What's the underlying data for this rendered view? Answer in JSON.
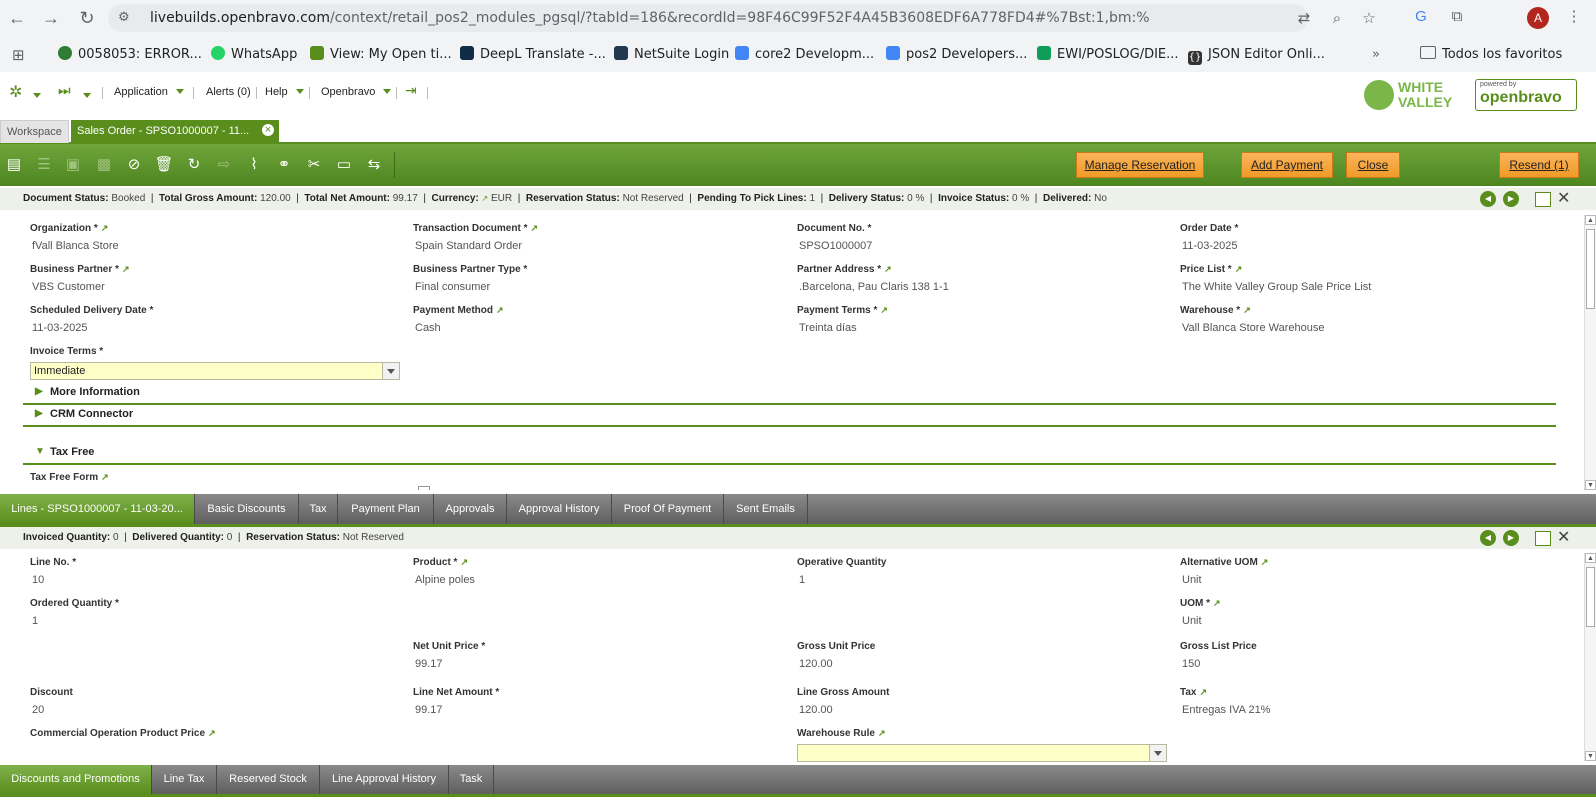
{
  "browser": {
    "url_host": "livebuilds.openbravo.com",
    "url_rest": "/context/retail_pos2_modules_pgsql/?tabId=186&recordId=98F46C99F52F4A45B3608EDF6A778FD4#%7Bst:1,bm:%5B%7BviewId:__OBMyOpenbravoImpl...",
    "avatar_letter": "A",
    "bookmarks": [
      {
        "label": "0058053: ERROR...",
        "color": "#2e7d32"
      },
      {
        "label": "WhatsApp",
        "color": "#25d366"
      },
      {
        "label": "View: My Open ti...",
        "color": "#5a8e1c"
      },
      {
        "label": "DeepL Translate -...",
        "color": "#0f2b46"
      },
      {
        "label": "NetSuite Login",
        "color": "#22384f"
      },
      {
        "label": "core2 Developm...",
        "color": "#4285f4"
      },
      {
        "label": "pos2 Developers...",
        "color": "#4285f4"
      },
      {
        "label": "EWI/POSLOG/DIE...",
        "color": "#0f9d58"
      },
      {
        "label": "JSON Editor Onli...",
        "color": "#333333"
      }
    ],
    "more_bookmarks": "»",
    "all_bookmarks": "Todos los favoritos"
  },
  "header": {
    "menu": {
      "application": "Application",
      "alerts": "Alerts (0)",
      "help": "Help",
      "openbravo": "Openbravo"
    },
    "logo_wv_line1": "WHITE",
    "logo_wv_line2": "VALLEY",
    "logo_ob_small": "powered by",
    "logo_ob": "openbravo"
  },
  "tabs": {
    "workspace": "Workspace",
    "sales_order": "Sales Order - SPSO1000007 - 11...",
    "close": "×"
  },
  "toolbar": {
    "manage_reservation": "Manage Reservation",
    "add_payment": "Add Payment",
    "close": "Close",
    "resend": "Resend (1)"
  },
  "header_status": {
    "document_status_label": "Document Status:",
    "document_status": "Booked",
    "total_gross_label": "Total Gross Amount:",
    "total_gross": "120.00",
    "total_net_label": "Total Net Amount:",
    "total_net": "99.17",
    "currency_label": "Currency:",
    "currency": "EUR",
    "reservation_label": "Reservation Status:",
    "reservation": "Not Reserved",
    "pending_label": "Pending To Pick Lines:",
    "pending": "1",
    "delivery_label": "Delivery Status:",
    "delivery": "0 %",
    "invoice_label": "Invoice Status:",
    "invoice": "0 %",
    "delivered_label": "Delivered:",
    "delivered": "No"
  },
  "header_form": {
    "organization_label": "Organization *",
    "organization": "fVall Blanca Store",
    "transaction_document_label": "Transaction Document *",
    "transaction_document": "Spain Standard Order",
    "document_no_label": "Document No. *",
    "document_no": "SPSO1000007",
    "order_date_label": "Order Date *",
    "order_date": "11-03-2025",
    "business_partner_label": "Business Partner *",
    "business_partner": "VBS Customer",
    "bp_type_label": "Business Partner Type *",
    "bp_type": "Final consumer",
    "partner_address_label": "Partner Address *",
    "partner_address": ".Barcelona, Pau Claris 138 1-1",
    "price_list_label": "Price List *",
    "price_list": "The White Valley Group Sale Price List",
    "scheduled_delivery_label": "Scheduled Delivery Date *",
    "scheduled_delivery": "11-03-2025",
    "payment_method_label": "Payment Method",
    "payment_method": "Cash",
    "payment_terms_label": "Payment Terms *",
    "payment_terms": "Treinta días",
    "warehouse_label": "Warehouse *",
    "warehouse": "Vall Blanca Store Warehouse",
    "invoice_terms_label": "Invoice Terms *",
    "invoice_terms": "Immediate",
    "section_more": "More Information",
    "section_crm": "CRM Connector",
    "section_tax_free": "Tax Free",
    "tax_free_form_label": "Tax Free Form"
  },
  "lines_tabs": [
    "Lines - SPSO1000007 - 11-03-20...",
    "Basic Discounts",
    "Tax",
    "Payment Plan",
    "Approvals",
    "Approval History",
    "Proof Of Payment",
    "Sent Emails"
  ],
  "lines_status": {
    "invoiced_label": "Invoiced Quantity:",
    "invoiced": "0",
    "delivered_label": "Delivered Quantity:",
    "delivered": "0",
    "reservation_label": "Reservation Status:",
    "reservation": "Not Reserved"
  },
  "lines_form": {
    "line_no_label": "Line No. *",
    "line_no": "10",
    "product_label": "Product *",
    "product": "Alpine poles",
    "operative_qty_label": "Operative Quantity",
    "operative_qty": "1",
    "alt_uom_label": "Alternative UOM",
    "alt_uom": "Unit",
    "ordered_qty_label": "Ordered Quantity *",
    "ordered_qty": "1",
    "uom_label": "UOM *",
    "uom": "Unit",
    "net_unit_price_label": "Net Unit Price *",
    "net_unit_price": "99.17",
    "gross_unit_price_label": "Gross Unit Price",
    "gross_unit_price": "120.00",
    "gross_list_price_label": "Gross List Price",
    "gross_list_price": "150",
    "discount_label": "Discount",
    "discount": "20",
    "line_net_amount_label": "Line Net Amount *",
    "line_net_amount": "99.17",
    "line_gross_amount_label": "Line Gross Amount",
    "line_gross_amount": "120.00",
    "tax_label": "Tax",
    "tax": "Entregas IVA 21%",
    "commercial_price_label": "Commercial Operation Product Price",
    "warehouse_rule_label": "Warehouse Rule",
    "warehouse_rule": ""
  },
  "bottom_tabs": [
    "Discounts and Promotions",
    "Line Tax",
    "Reserved Stock",
    "Line Approval History",
    "Task"
  ],
  "colors": {
    "accent": "#5a8e1c",
    "orange": "#f09a28",
    "yellow_field": "#ffffc8"
  }
}
